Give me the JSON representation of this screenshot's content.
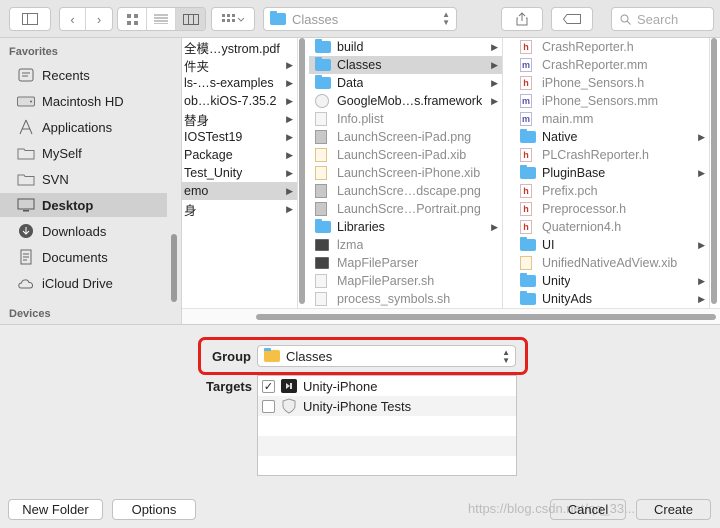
{
  "toolbar": {
    "path_label": "Classes",
    "search_placeholder": "Search"
  },
  "sidebar": {
    "favorites_title": "Favorites",
    "items": [
      {
        "label": "Recents",
        "icon": "clock-icon"
      },
      {
        "label": "Macintosh HD",
        "icon": "drive-icon"
      },
      {
        "label": "Applications",
        "icon": "applications-icon"
      },
      {
        "label": "MySelf",
        "icon": "folder-icon"
      },
      {
        "label": "SVN",
        "icon": "folder-icon"
      },
      {
        "label": "Desktop",
        "icon": "desktop-icon",
        "selected": true
      },
      {
        "label": "Downloads",
        "icon": "download-icon"
      },
      {
        "label": "Documents",
        "icon": "documents-icon"
      },
      {
        "label": "iCloud Drive",
        "icon": "cloud-icon"
      }
    ],
    "devices_title": "Devices"
  },
  "columns": {
    "col1": [
      {
        "name": "全模…ystrom.pdf",
        "chev": false
      },
      {
        "name": "件夹",
        "chev": true
      },
      {
        "name": "ls-…s-examples",
        "chev": true
      },
      {
        "name": "ob…kiOS-7.35.2",
        "chev": true
      },
      {
        "name": "替身",
        "chev": true
      },
      {
        "name": "IOSTest19",
        "chev": true
      },
      {
        "name": "Package",
        "chev": true
      },
      {
        "name": "Test_Unity",
        "chev": true
      },
      {
        "name": "emo",
        "chev": true,
        "selected": true
      },
      {
        "name": "身",
        "chev": true
      }
    ],
    "col2": [
      {
        "name": "build",
        "type": "folder",
        "chev": true
      },
      {
        "name": "Classes",
        "type": "folder",
        "chev": true,
        "selected": true
      },
      {
        "name": "Data",
        "type": "folder",
        "chev": true
      },
      {
        "name": "GoogleMob…s.framework",
        "type": "fw",
        "chev": true
      },
      {
        "name": "Info.plist",
        "type": "doc",
        "dim": true
      },
      {
        "name": "LaunchScreen-iPad.png",
        "type": "png",
        "dim": true
      },
      {
        "name": "LaunchScreen-iPad.xib",
        "type": "xib",
        "dim": true
      },
      {
        "name": "LaunchScreen-iPhone.xib",
        "type": "xib",
        "dim": true
      },
      {
        "name": "LaunchScre…dscape.png",
        "type": "png",
        "dim": true
      },
      {
        "name": "LaunchScre…Portrait.png",
        "type": "png",
        "dim": true
      },
      {
        "name": "Libraries",
        "type": "folder",
        "chev": true
      },
      {
        "name": "lzma",
        "type": "exec",
        "dim": true
      },
      {
        "name": "MapFileParser",
        "type": "exec",
        "dim": true
      },
      {
        "name": "MapFileParser.sh",
        "type": "doc",
        "dim": true
      },
      {
        "name": "process_symbols.sh",
        "type": "doc",
        "dim": true
      }
    ],
    "col3": [
      {
        "name": "CrashReporter.h",
        "type": "h",
        "dim": true
      },
      {
        "name": "CrashReporter.mm",
        "type": "m",
        "dim": true
      },
      {
        "name": "iPhone_Sensors.h",
        "type": "h",
        "dim": true
      },
      {
        "name": "iPhone_Sensors.mm",
        "type": "m",
        "dim": true
      },
      {
        "name": "main.mm",
        "type": "m",
        "dim": true
      },
      {
        "name": "Native",
        "type": "folder",
        "chev": true
      },
      {
        "name": "PLCrashReporter.h",
        "type": "h",
        "dim": true
      },
      {
        "name": "PluginBase",
        "type": "folder",
        "chev": true
      },
      {
        "name": "Prefix.pch",
        "type": "h",
        "dim": true
      },
      {
        "name": "Preprocessor.h",
        "type": "h",
        "dim": true
      },
      {
        "name": "Quaternion4.h",
        "type": "h",
        "dim": true
      },
      {
        "name": "UI",
        "type": "folder",
        "chev": true
      },
      {
        "name": "UnifiedNativeAdView.xib",
        "type": "xib",
        "dim": true
      },
      {
        "name": "Unity",
        "type": "folder",
        "chev": true
      },
      {
        "name": "UnityAds",
        "type": "folder",
        "chev": true
      }
    ]
  },
  "group": {
    "label": "Group",
    "value": "Classes"
  },
  "targets": {
    "label": "Targets",
    "items": [
      {
        "name": "Unity-iPhone",
        "checked": true
      },
      {
        "name": "Unity-iPhone Tests",
        "checked": false
      }
    ]
  },
  "buttons": {
    "new_folder": "New Folder",
    "options": "Options",
    "cancel": "Cancel",
    "create": "Create"
  },
  "watermark": "https://blog.csdn.net/qq_33..."
}
